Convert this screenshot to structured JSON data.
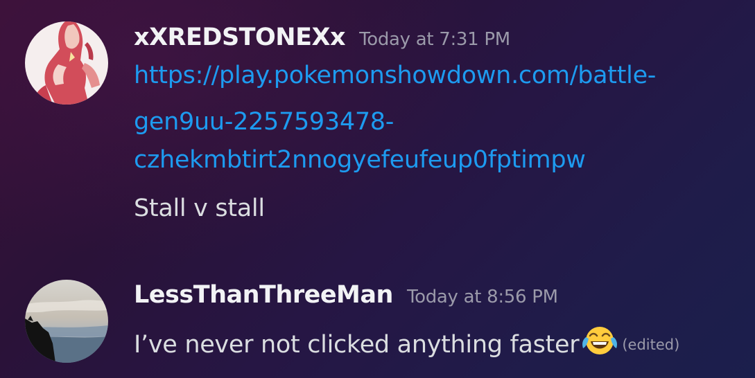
{
  "messages": [
    {
      "username": "xXREDSTONEXx",
      "timestamp": "Today at 7:31 PM",
      "link_lines": [
        "https://play.pokemonshowdown.com/battle-",
        "gen9uu-2257593478-",
        "czhekmbtirt2nnogyefeufeup0fptimpw"
      ],
      "text": "Stall v stall"
    },
    {
      "username": "LessThanThreeMan",
      "timestamp": "Today at 8:56 PM",
      "text": "I’ve never not clicked anything faster",
      "emoji": "joy-emoji",
      "edited_label": "(edited)"
    }
  ],
  "colors": {
    "link": "#1d9bf0",
    "username": "#f2f3f5",
    "message_text": "#dbdee1",
    "timestamp": "#9b9aaa"
  }
}
